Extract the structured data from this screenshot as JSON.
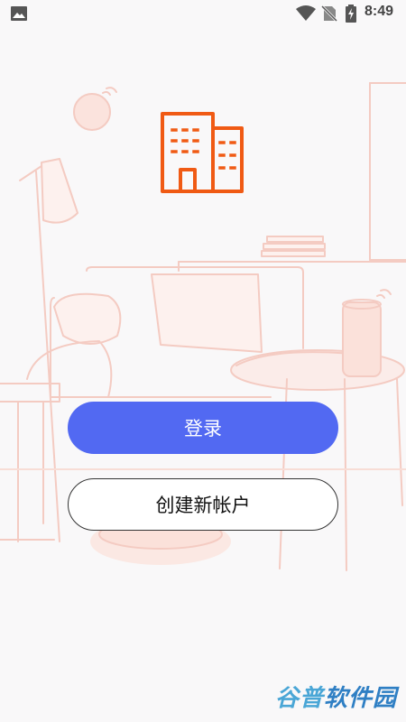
{
  "status_bar": {
    "time": "8:49",
    "icons": [
      "gallery-icon",
      "wifi-icon",
      "no-sim-icon",
      "battery-charging-icon"
    ]
  },
  "logo": {
    "icon": "building-icon",
    "color": "#f05a14"
  },
  "actions": {
    "login_label": "登录",
    "register_label": "创建新帐户"
  },
  "colors": {
    "primary": "#5269f2",
    "background": "#f9f8f9",
    "illustration_line": "#f4c7bd"
  },
  "watermark": {
    "part1": "谷普",
    "part2": "软件园"
  }
}
